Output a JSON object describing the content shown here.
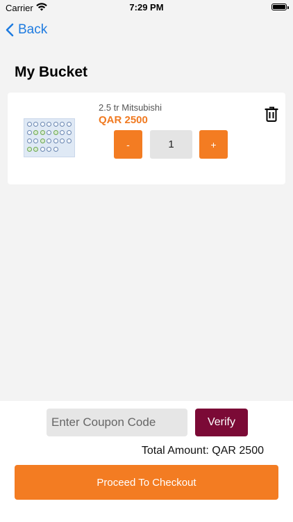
{
  "status_bar": {
    "carrier": "Carrier",
    "time": "7:29 PM"
  },
  "nav": {
    "back_label": "Back"
  },
  "page": {
    "title": "My Bucket"
  },
  "cart": {
    "items": [
      {
        "name": "2.5  tr Mitsubishi",
        "price": "QAR 2500",
        "quantity": "1",
        "minus_label": "-",
        "plus_label": "+"
      }
    ]
  },
  "checkout": {
    "coupon_placeholder": "Enter Coupon Code",
    "verify_label": "Verify",
    "total_text": "Total Amount: QAR 2500",
    "proceed_label": "Proceed To Checkout"
  },
  "colors": {
    "accent": "#f37c22",
    "verify": "#7b0a36",
    "link": "#1e7be0"
  },
  "icons": {
    "back": "chevron-left-icon",
    "delete": "trash-icon",
    "wifi": "wifi-icon",
    "battery": "battery-icon"
  }
}
